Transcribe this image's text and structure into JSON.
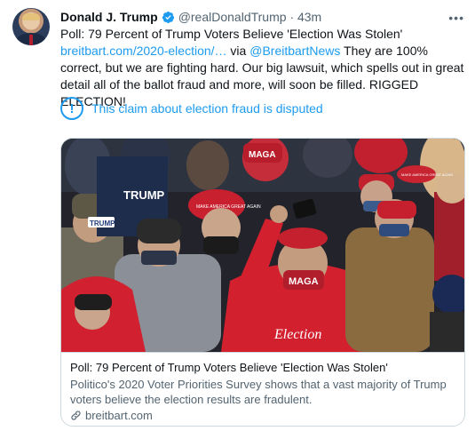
{
  "author": {
    "name": "Donald J. Trump",
    "handle": "@realDonaldTrump",
    "time": "· 43m"
  },
  "tweet": {
    "text_before": "Poll: 79 Percent of Trump Voters Believe 'Election Was Stolen'",
    "link_url": "breitbart.com/2020-election/…",
    "via": " via ",
    "mention": "@BreitbartNews",
    "text_after": " They are 100% correct, but we are fighting hard. Our big lawsuit, which spells out in great detail all of the ballot fraud and more, will soon be filled. RIGGED ELECTION!"
  },
  "notice": {
    "icon_glyph": "!",
    "text": "This claim about election fraud is disputed"
  },
  "card": {
    "title": "Poll: 79 Percent of Trump Voters Believe 'Election Was Stolen'",
    "description": "Politico's 2020 Voter Priorities Survey shows that a vast majority of Trump voters believe the election results are fradulent.",
    "domain": "breitbart.com",
    "image_texts": {
      "mask_1": "MAGA",
      "mask_2": "MAGA",
      "hat_1": "MAKE AMERICA GREAT AGAIN",
      "hat_2": "MAKE AMERICA GREAT AGAIN",
      "hoodie": "Election",
      "shirt_1": "TRUMP",
      "badge": "TRUMP"
    }
  },
  "icons": {
    "more": "more-options-icon",
    "verified": "verified-badge-icon",
    "notice": "info-exclamation-icon",
    "link": "link-icon"
  },
  "colors": {
    "accent": "#1d9bf0",
    "text": "#0f1419",
    "muted": "#536471",
    "border": "#cfd9de"
  }
}
